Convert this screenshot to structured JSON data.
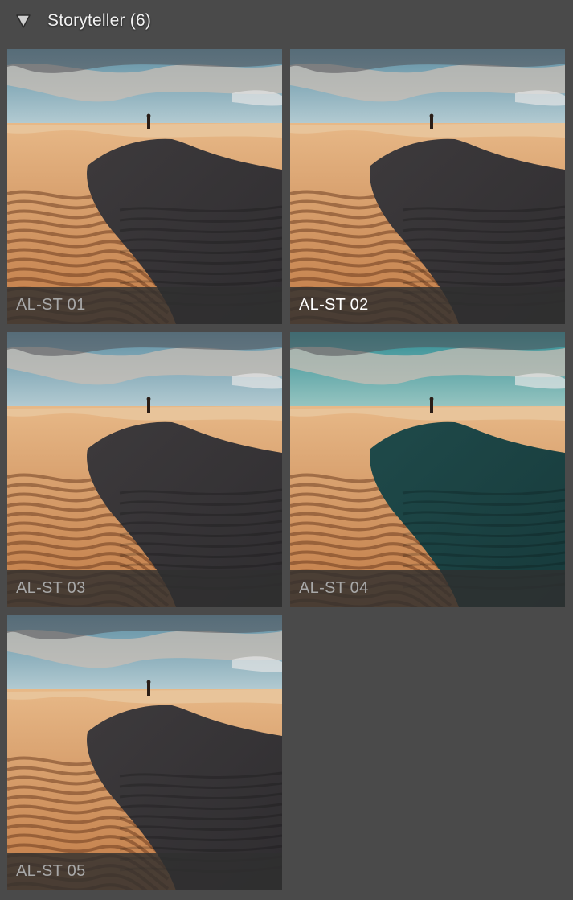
{
  "group": {
    "title": "Storyteller (6)",
    "expanded": true
  },
  "presets": [
    {
      "label": "AL-ST 01",
      "selected": false,
      "tint": ""
    },
    {
      "label": "AL-ST 02",
      "selected": true,
      "tint": ""
    },
    {
      "label": "AL-ST 03",
      "selected": false,
      "tint": ""
    },
    {
      "label": "AL-ST 04",
      "selected": false,
      "tint": "teal"
    },
    {
      "label": "AL-ST 05",
      "selected": false,
      "tint": ""
    }
  ],
  "icons": {
    "disclosure": "disclosure-triangle-down-icon"
  },
  "colors": {
    "background": "#4a4a4a",
    "selection_border": "#e3e3e3",
    "caption_text": "#a8a8a8",
    "caption_text_selected": "#ffffff"
  }
}
